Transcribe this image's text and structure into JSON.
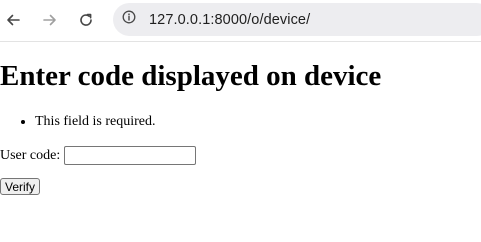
{
  "browser": {
    "url": "127.0.0.1:8000/o/device/"
  },
  "page": {
    "heading": "Enter code displayed on device",
    "errors": [
      "This field is required."
    ],
    "form": {
      "user_code_label": "User code:",
      "user_code_value": "",
      "submit_label": "Verify"
    }
  },
  "icons": {
    "back": "back-arrow-icon",
    "forward": "forward-arrow-icon",
    "reload": "reload-icon",
    "site_info": "info-icon"
  },
  "colors": {
    "toolbar_bg": "#ffffff",
    "omnibox_bg": "#ededf0",
    "icon_active": "#474747",
    "icon_disabled": "#a0a0a0"
  }
}
